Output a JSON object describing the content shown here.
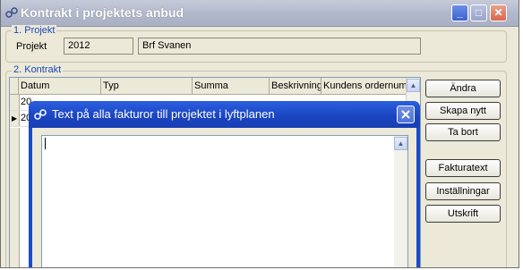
{
  "window": {
    "title": "Kontrakt i projektets anbud"
  },
  "projekt": {
    "group_label": "1. Projekt",
    "label": "Projekt",
    "number": "2012",
    "name": "Brf Svanen"
  },
  "kontrakt": {
    "group_label": "2. Kontrakt",
    "columns": [
      "Datum",
      "Typ",
      "Summa",
      "Beskrivning",
      "Kundens ordernum"
    ],
    "rows": [
      {
        "datum": "20"
      },
      {
        "datum": "20"
      }
    ]
  },
  "buttons": {
    "andra": "Ändra",
    "skapa_nytt": "Skapa nytt",
    "ta_bort": "Ta bort",
    "fakturatext": "Fakturatext",
    "installningar": "Inställningar",
    "utskrift": "Utskrift"
  },
  "dialog": {
    "title": "Text på alla fakturor till projektet i lyftplanen",
    "text_value": ""
  },
  "colors": {
    "accent": "#1c4cc9",
    "group_label": "#1a48b8"
  }
}
